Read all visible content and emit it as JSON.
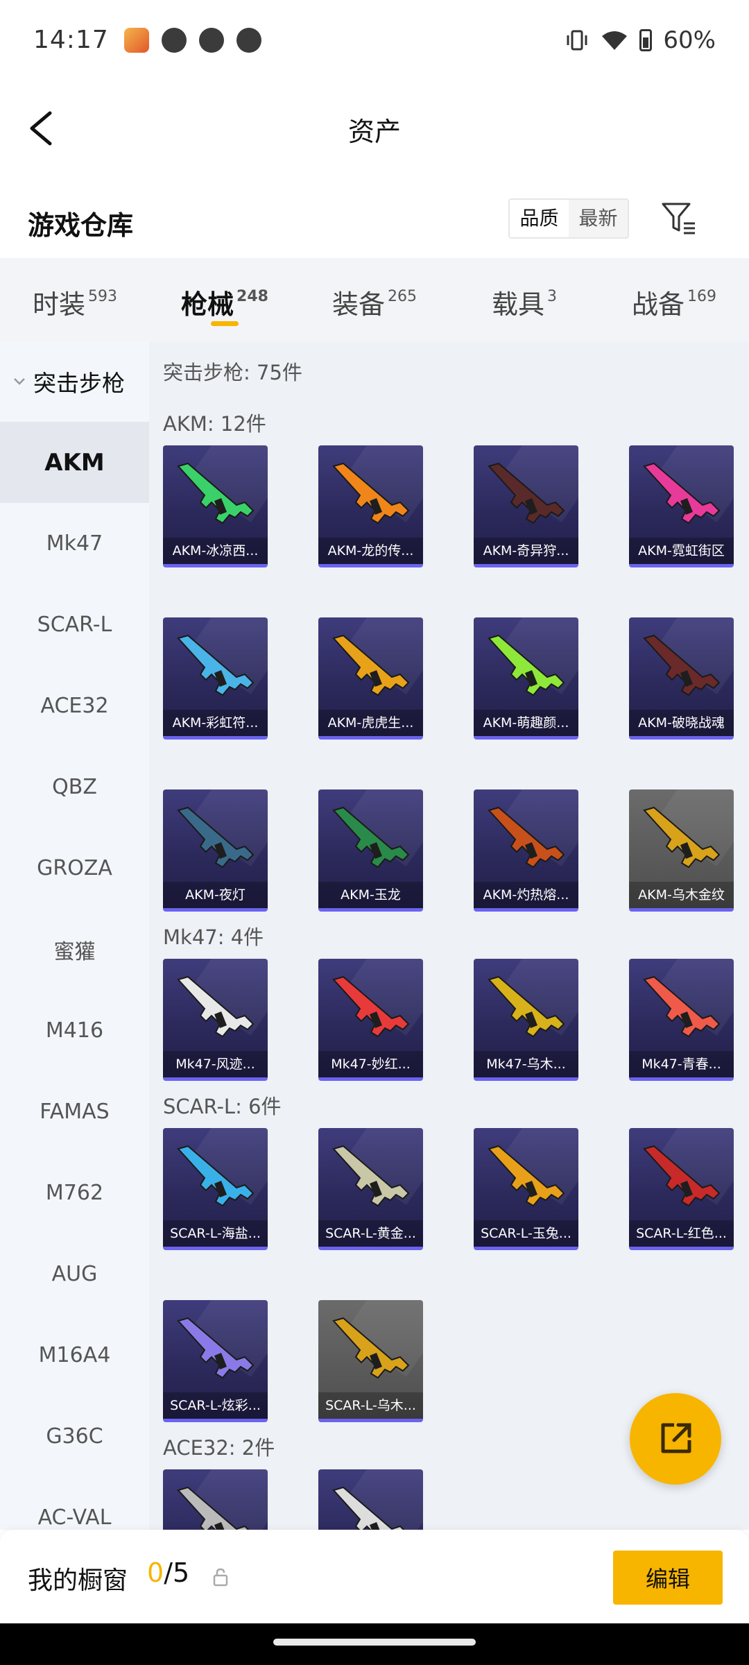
{
  "status_bar": {
    "time": "14:17",
    "battery": "60%"
  },
  "header": {
    "title": "资产"
  },
  "warehouse": {
    "title": "游戏仓库",
    "sort_options": [
      "品质",
      "最新"
    ]
  },
  "tabs": [
    {
      "label": "时装",
      "count": "593"
    },
    {
      "label": "枪械",
      "count": "248",
      "active": true
    },
    {
      "label": "装备",
      "count": "265"
    },
    {
      "label": "载具",
      "count": "3"
    },
    {
      "label": "战备",
      "count": "169"
    }
  ],
  "sidebar": {
    "group": "突击步枪",
    "items": [
      "AKM",
      "Mk47",
      "SCAR-L",
      "ACE32",
      "QBZ",
      "GROZA",
      "蜜獾",
      "M416",
      "FAMAS",
      "M762",
      "AUG",
      "M16A4",
      "G36C",
      "AC-VAL"
    ],
    "active": "AKM"
  },
  "content": {
    "category_summary": "突击步枪: 75件",
    "sections": [
      {
        "header": "AKM: 12件",
        "items": [
          {
            "label": "AKM-冰凉西...",
            "color": "#3ad16a"
          },
          {
            "label": "AKM-龙的传...",
            "color": "#f0861a"
          },
          {
            "label": "AKM-奇异狩...",
            "color": "#5a2a2a"
          },
          {
            "label": "AKM-霓虹街区",
            "color": "#e83a9a"
          },
          {
            "label": "AKM-彩虹符...",
            "color": "#4ab3e8"
          },
          {
            "label": "AKM-虎虎生...",
            "color": "#e8a21a"
          },
          {
            "label": "AKM-萌趣颜...",
            "color": "#8ee83a"
          },
          {
            "label": "AKM-破晓战魂",
            "color": "#6a2a2a"
          },
          {
            "label": "AKM-夜灯",
            "color": "#3a6a8a"
          },
          {
            "label": "AKM-玉龙",
            "color": "#2a8a4a"
          },
          {
            "label": "AKM-灼热熔...",
            "color": "#c8501a"
          },
          {
            "label": "AKM-乌木金纹",
            "color": "#d8a21a",
            "grey": true
          }
        ]
      },
      {
        "header": "Mk47: 4件",
        "items": [
          {
            "label": "Mk47-风迹...",
            "color": "#e8e8e8"
          },
          {
            "label": "Mk47-妙红...",
            "color": "#e83a3a"
          },
          {
            "label": "Mk47-乌木...",
            "color": "#d8b21a"
          },
          {
            "label": "Mk47-青春...",
            "color": "#f05a4a"
          }
        ]
      },
      {
        "header": "SCAR-L: 6件",
        "items": [
          {
            "label": "SCAR-L-海盐...",
            "color": "#3ab0e8"
          },
          {
            "label": "SCAR-L-黄金...",
            "color": "#c8c8a8"
          },
          {
            "label": "SCAR-L-玉兔...",
            "color": "#e8a01a"
          },
          {
            "label": "SCAR-L-红色...",
            "color": "#c82a2a"
          },
          {
            "label": "SCAR-L-炫彩...",
            "color": "#8a7ae8"
          },
          {
            "label": "SCAR-L-乌木...",
            "color": "#d8a21a",
            "grey": true
          }
        ]
      },
      {
        "header": "ACE32: 2件",
        "items": [
          {
            "label": "",
            "color": "#bbbbbb"
          },
          {
            "label": "",
            "color": "#dddddd"
          }
        ]
      }
    ]
  },
  "bottom_bar": {
    "label": "我的橱窗",
    "count": "0",
    "total": "/5",
    "edit_label": "编辑"
  }
}
